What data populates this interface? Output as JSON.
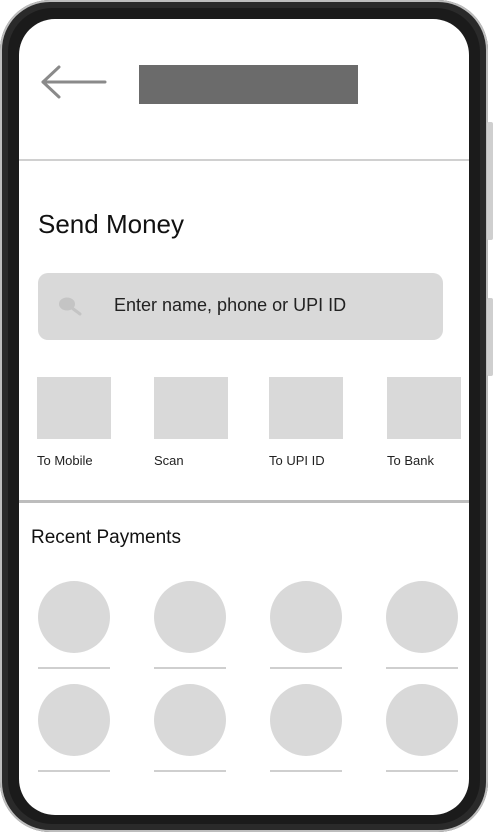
{
  "screen": {
    "title": "Send Money",
    "search": {
      "placeholder": "Enter name, phone or UPI ID"
    },
    "actions": [
      {
        "label": "To Mobile"
      },
      {
        "label": "Scan"
      },
      {
        "label": "To UPI ID"
      },
      {
        "label": "To Bank"
      }
    ],
    "recent": {
      "title": "Recent Payments",
      "contact_count": 8
    }
  },
  "icons": [
    "back-arrow-icon",
    "search-icon"
  ],
  "colors": {
    "placeholder_gray": "#d9d9d9",
    "header_block": "#6b6b6b",
    "frame": "#2a2a2a"
  }
}
